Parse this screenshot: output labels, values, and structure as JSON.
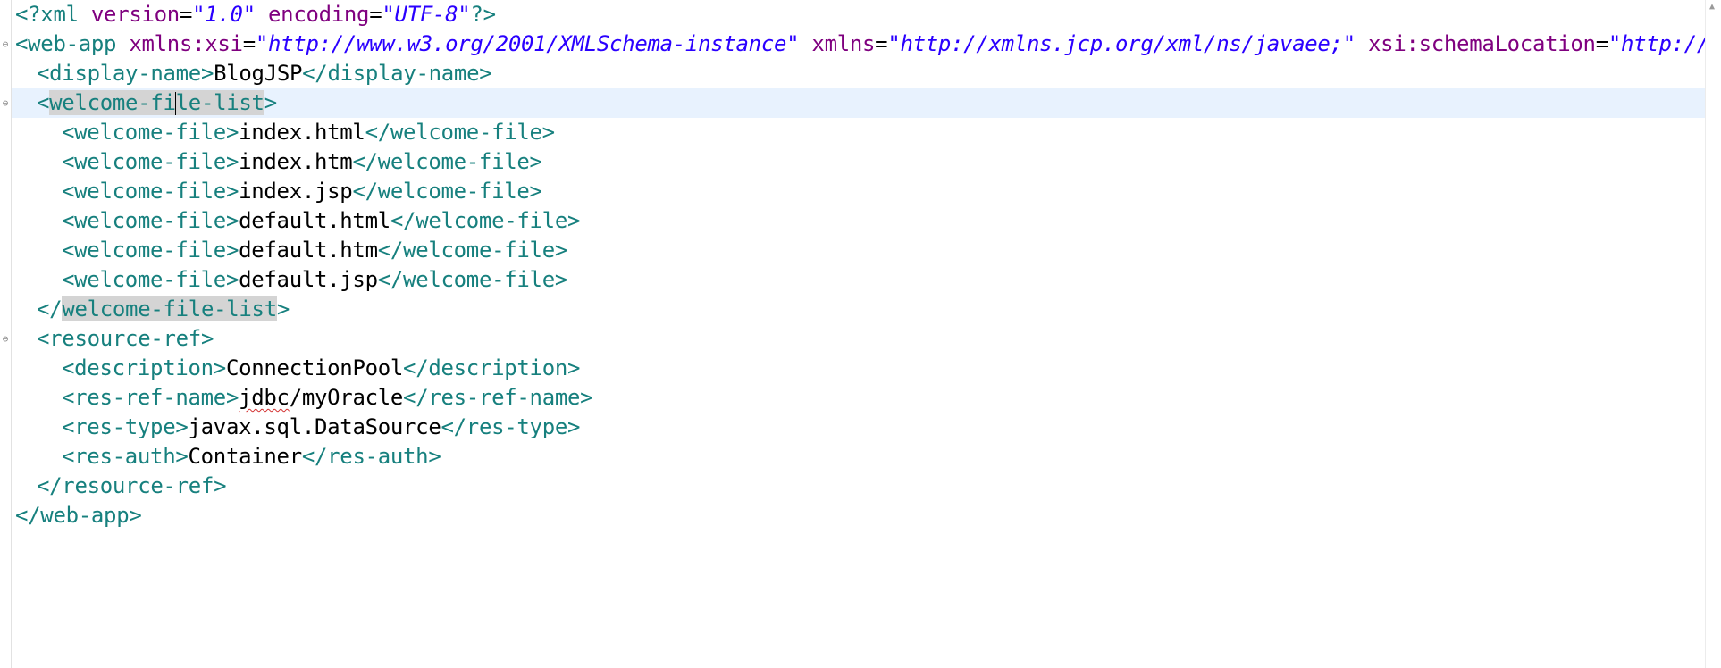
{
  "editor": {
    "lines": [
      {
        "indent": 0,
        "fold": false,
        "tokens": [
          {
            "t": "pi",
            "v": "<?xml "
          },
          {
            "t": "attr",
            "v": "version"
          },
          {
            "t": "txt",
            "v": "="
          },
          {
            "t": "val",
            "v": "\"1.0\""
          },
          {
            "t": "txt",
            "v": " "
          },
          {
            "t": "attr",
            "v": "encoding"
          },
          {
            "t": "txt",
            "v": "="
          },
          {
            "t": "val",
            "v": "\"UTF-8\""
          },
          {
            "t": "pi",
            "v": "?>"
          }
        ]
      },
      {
        "indent": 0,
        "fold": true,
        "tokens": [
          {
            "t": "tag",
            "v": "<web-app "
          },
          {
            "t": "attr",
            "v": "xmlns:xsi"
          },
          {
            "t": "txt",
            "v": "="
          },
          {
            "t": "val",
            "v": "\"http://www.w3.org/2001/XMLSchema-instance\""
          },
          {
            "t": "txt",
            "v": " "
          },
          {
            "t": "attr",
            "v": "xmlns"
          },
          {
            "t": "txt",
            "v": "="
          },
          {
            "t": "val",
            "v": "\"http://xmlns.jcp.org/xml/ns/javaee;\""
          },
          {
            "t": "txt",
            "v": " "
          },
          {
            "t": "attr",
            "v": "xsi:schemaLocation"
          },
          {
            "t": "txt",
            "v": "="
          },
          {
            "t": "val",
            "v": "\"http://xmlns."
          }
        ]
      },
      {
        "indent": 1,
        "fold": false,
        "tokens": [
          {
            "t": "tag",
            "v": "<display-name>"
          },
          {
            "t": "txt",
            "v": "BlogJSP"
          },
          {
            "t": "tag",
            "v": "</display-name>"
          }
        ]
      },
      {
        "indent": 1,
        "fold": true,
        "current": true,
        "tokens": [
          {
            "t": "tag",
            "v": "<"
          },
          {
            "t": "tag-hl",
            "v": "welcome-fi"
          },
          {
            "t": "caret",
            "v": ""
          },
          {
            "t": "tag-hl",
            "v": "le-list"
          },
          {
            "t": "tag",
            "v": ">"
          }
        ]
      },
      {
        "indent": 2,
        "fold": false,
        "tokens": [
          {
            "t": "tag",
            "v": "<welcome-file>"
          },
          {
            "t": "txt",
            "v": "index.html"
          },
          {
            "t": "tag",
            "v": "</welcome-file>"
          }
        ]
      },
      {
        "indent": 2,
        "fold": false,
        "tokens": [
          {
            "t": "tag",
            "v": "<welcome-file>"
          },
          {
            "t": "txt",
            "v": "index.htm"
          },
          {
            "t": "tag",
            "v": "</welcome-file>"
          }
        ]
      },
      {
        "indent": 2,
        "fold": false,
        "tokens": [
          {
            "t": "tag",
            "v": "<welcome-file>"
          },
          {
            "t": "txt",
            "v": "index.jsp"
          },
          {
            "t": "tag",
            "v": "</welcome-file>"
          }
        ]
      },
      {
        "indent": 2,
        "fold": false,
        "tokens": [
          {
            "t": "tag",
            "v": "<welcome-file>"
          },
          {
            "t": "txt",
            "v": "default.html"
          },
          {
            "t": "tag",
            "v": "</welcome-file>"
          }
        ]
      },
      {
        "indent": 2,
        "fold": false,
        "tokens": [
          {
            "t": "tag",
            "v": "<welcome-file>"
          },
          {
            "t": "txt",
            "v": "default.htm"
          },
          {
            "t": "tag",
            "v": "</welcome-file>"
          }
        ]
      },
      {
        "indent": 2,
        "fold": false,
        "tokens": [
          {
            "t": "tag",
            "v": "<welcome-file>"
          },
          {
            "t": "txt",
            "v": "default.jsp"
          },
          {
            "t": "tag",
            "v": "</welcome-file>"
          }
        ]
      },
      {
        "indent": 1,
        "fold": false,
        "tokens": [
          {
            "t": "tag",
            "v": "</"
          },
          {
            "t": "tag-hl",
            "v": "welcome-file-list"
          },
          {
            "t": "tag",
            "v": ">"
          }
        ]
      },
      {
        "indent": 1,
        "fold": true,
        "tokens": [
          {
            "t": "tag",
            "v": "<resource-ref>"
          }
        ]
      },
      {
        "indent": 2,
        "fold": false,
        "tokens": [
          {
            "t": "tag",
            "v": "<description>"
          },
          {
            "t": "txt",
            "v": "ConnectionPool"
          },
          {
            "t": "tag",
            "v": "</description>"
          }
        ]
      },
      {
        "indent": 2,
        "fold": false,
        "tokens": [
          {
            "t": "tag",
            "v": "<res-ref-name>"
          },
          {
            "t": "txt-squiggle",
            "v": "jdbc"
          },
          {
            "t": "txt",
            "v": "/myOracle"
          },
          {
            "t": "tag",
            "v": "</res-ref-name>"
          }
        ]
      },
      {
        "indent": 2,
        "fold": false,
        "tokens": [
          {
            "t": "tag",
            "v": "<res-type>"
          },
          {
            "t": "txt",
            "v": "javax.sql.DataSource"
          },
          {
            "t": "tag",
            "v": "</res-type>"
          }
        ]
      },
      {
        "indent": 2,
        "fold": false,
        "tokens": [
          {
            "t": "tag",
            "v": "<res-auth>"
          },
          {
            "t": "txt",
            "v": "Container"
          },
          {
            "t": "tag",
            "v": "</res-auth>"
          }
        ]
      },
      {
        "indent": 1,
        "fold": false,
        "tokens": [
          {
            "t": "tag",
            "v": "</resource-ref>"
          }
        ]
      },
      {
        "indent": 0,
        "fold": false,
        "tokens": [
          {
            "t": "tag",
            "v": "</web-app>"
          }
        ]
      }
    ]
  },
  "colors": {
    "tag": "#17807e",
    "attr": "#7f007f",
    "value": "#2a00ff",
    "text": "#000000",
    "current_line": "#e8f2fe",
    "occurrence_highlight": "#d4d4d4"
  },
  "icons": {
    "fold": "fold-collapse-icon",
    "scroll_up": "scroll-up-arrow-icon"
  }
}
